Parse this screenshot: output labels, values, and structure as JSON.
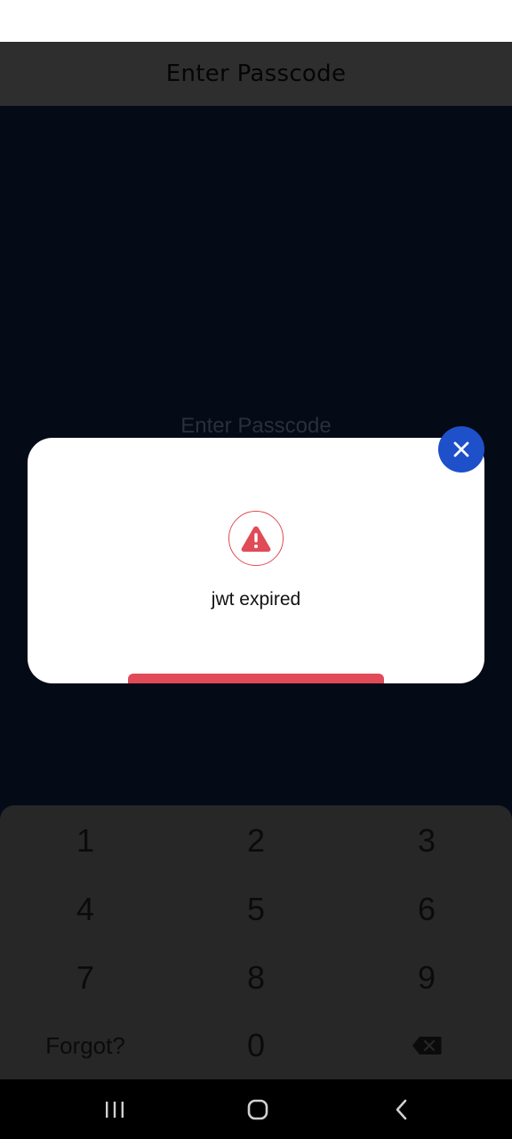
{
  "header": {
    "title": "Enter Passcode"
  },
  "main": {
    "prompt": "Enter Passcode"
  },
  "modal": {
    "message": "jwt expired",
    "icon": "warning-triangle-icon",
    "close_icon": "close-icon",
    "accent_color": "#e14a57",
    "close_color": "#1d50c9",
    "timer_progress": 1.0
  },
  "keypad": {
    "keys": [
      "1",
      "2",
      "3",
      "4",
      "5",
      "6",
      "7",
      "8",
      "9"
    ],
    "forgot_label": "Forgot?",
    "zero": "0",
    "backspace_icon": "backspace-icon"
  },
  "navbar": {
    "recents_icon": "recents-icon",
    "home_icon": "home-icon",
    "back_icon": "back-icon"
  }
}
